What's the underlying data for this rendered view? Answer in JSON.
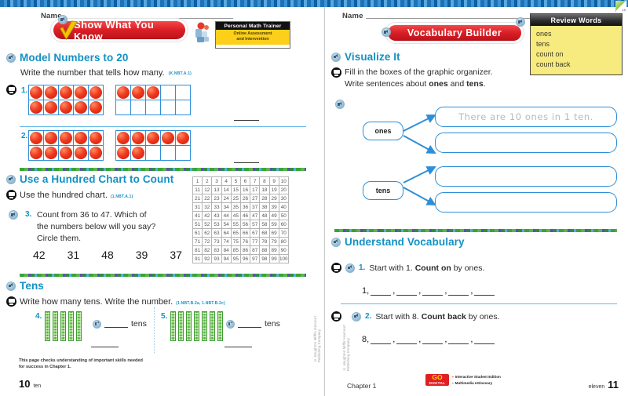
{
  "book": {
    "left_page_number": "10",
    "left_page_word": "ten",
    "right_page_number": "11",
    "right_page_word": "eleven",
    "chapter_label": "Chapter 1",
    "corner_tab": "10",
    "copyright_left": "© Houghton Mifflin Harcourt Publishing Company",
    "copyright_right": "© Houghton Mifflin Harcourt Publishing Company"
  },
  "colors": {
    "heading_teal": "#1391c4",
    "banner_red": "#dc1f26",
    "frame_blue": "#2e8fd8",
    "counter_red": "#ef3b1e",
    "rod_green": "#4fae3c",
    "review_yellow": "#f7ea7f",
    "trainer_yellow": "#fccf1a"
  },
  "left": {
    "name_label": "Name",
    "banner": "Show What You Know",
    "trainer": {
      "title": "Personal Math Trainer",
      "line1": "Online Assessment",
      "line2": "and Intervention"
    },
    "section1": {
      "heading": "Model Numbers to 20",
      "instruction": "Write the number that tells how many.",
      "standard": "(K.NBT.A.1)",
      "problems": [
        {
          "number": "1.",
          "frames": [
            10,
            3
          ],
          "answer": ""
        },
        {
          "number": "2.",
          "frames": [
            10,
            7
          ],
          "answer": ""
        }
      ]
    },
    "section2": {
      "heading": "Use a Hundred Chart to Count",
      "instruction": "Use the hundred chart.",
      "standard": "(1.NBT.A.1)",
      "problem": {
        "number": "3.",
        "text_line1": "Count from 36 to 47. Which of",
        "text_line2": "the numbers  below will you say?",
        "text_line3": "Circle them.",
        "choices": [
          "42",
          "31",
          "48",
          "39",
          "37"
        ]
      },
      "hundred_chart_rows": [
        [
          1,
          2,
          3,
          4,
          5,
          6,
          7,
          8,
          9,
          10
        ],
        [
          11,
          12,
          13,
          14,
          15,
          16,
          17,
          18,
          19,
          20
        ],
        [
          21,
          22,
          23,
          24,
          25,
          26,
          27,
          28,
          29,
          30
        ],
        [
          31,
          32,
          33,
          34,
          35,
          36,
          37,
          38,
          39,
          40
        ],
        [
          41,
          42,
          43,
          44,
          45,
          46,
          47,
          48,
          49,
          50
        ],
        [
          51,
          52,
          53,
          54,
          55,
          56,
          57,
          58,
          59,
          60
        ],
        [
          61,
          62,
          63,
          64,
          65,
          66,
          67,
          68,
          69,
          70
        ],
        [
          71,
          72,
          73,
          74,
          75,
          76,
          77,
          78,
          79,
          80
        ],
        [
          81,
          82,
          83,
          84,
          85,
          86,
          87,
          88,
          89,
          90
        ],
        [
          91,
          92,
          93,
          94,
          95,
          96,
          97,
          98,
          99,
          100
        ]
      ]
    },
    "section3": {
      "heading": "Tens",
      "instruction": "Write how many tens. Write the number.",
      "standard": "(1.NBT.B.2a, 1.NBT.B.2c)",
      "problems": [
        {
          "number": "4.",
          "rods": 5,
          "unit_label": "tens"
        },
        {
          "number": "5.",
          "rods": 7,
          "unit_label": "tens"
        }
      ]
    },
    "footnote_line1": "This page checks understanding of important skills needed",
    "footnote_line2": "for success in Chapter 1."
  },
  "right": {
    "name_label": "Name",
    "banner": "Vocabulary Builder",
    "review_words": {
      "title": "Review Words",
      "items": [
        "ones",
        "tens",
        "count on",
        "count back"
      ]
    },
    "visualize": {
      "heading": "Visualize It",
      "instruction_line1": "Fill in the boxes of the graphic organizer.",
      "instruction_line2_pre": "Write sentences about ",
      "instruction_line2_b1": "ones",
      "instruction_line2_mid": " and ",
      "instruction_line2_b2": "tens",
      "instruction_line2_end": "."
    },
    "organizer": {
      "node1": "ones",
      "node2": "tens",
      "box1_filled": "There are 10 ones in 1 ten.",
      "box2_filled": "",
      "box3_filled": "",
      "box4_filled": ""
    },
    "understand": {
      "heading": "Understand Vocabulary",
      "problems": [
        {
          "number": "1.",
          "pre": "Start with 1. ",
          "bold": "Count on",
          "post": " by ones.",
          "start": "1,",
          "blanks": 5
        },
        {
          "number": "2.",
          "pre": "Start with 8. ",
          "bold": "Count back",
          "post": " by ones.",
          "start": "8,",
          "blanks": 5
        }
      ]
    },
    "go_digital": {
      "logo_top": "GO",
      "logo_bottom": "DIGITAL",
      "line1": "Interactive Student Edition",
      "line2": "Multimedia eGlossary"
    }
  },
  "icons": {
    "speaker": "speaker-icon",
    "mathboard": "mathboard-icon",
    "check": "check-mark-icon"
  }
}
